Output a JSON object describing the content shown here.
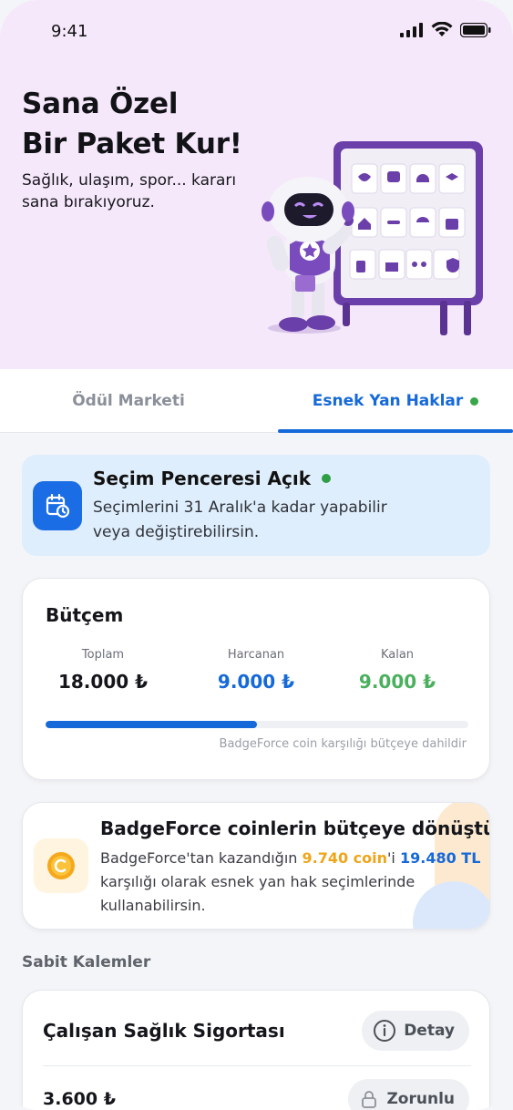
{
  "status": {
    "time": "9:41"
  },
  "hero": {
    "title_line1": "Sana Özel",
    "title_line2": "Bir Paket Kur!",
    "subtitle_line1": "Sağlık, ulaşım, spor... kararı",
    "subtitle_line2": "sana bırakıyoruz."
  },
  "tabs": [
    {
      "label": "Ödül Marketi",
      "active": false
    },
    {
      "label": "Esnek Yan Haklar",
      "active": true
    }
  ],
  "banner": {
    "title": "Seçim Penceresi Açık",
    "line1": "Seçimlerini 31 Aralık'a kadar yapabilir",
    "line2": "veya değiştirebilirsin.",
    "icon": "calendar-clock-icon"
  },
  "budget": {
    "title": "Bütçem",
    "total_label": "Toplam",
    "total_value": "18.000 ₺",
    "spent_label": "Harcanan",
    "spent_value": "9.000 ₺",
    "left_label": "Kalan",
    "left_value": "9.000 ₺",
    "progress_fraction": 0.5,
    "note": "BadgeForce coin karşılığı bütçeye dahildir"
  },
  "coin": {
    "title": "BadgeForce coinlerin bütçeye dönüştü",
    "text_pre": "BadgeForce'tan kazandığın ",
    "coin_amount": "9.740 coin",
    "text_mid": "'i ",
    "tl_amount": "19.480 TL",
    "line2": "karşılığı olarak esnek yan hak seçimlerinde",
    "line3": "kullanabilirsin."
  },
  "fixed_section": {
    "label": "Sabit Kalemler",
    "item_title": "Çalışan Sağlık Sigortası",
    "detail_label": "Detay",
    "price": "3.600 ₺",
    "required_label": "Zorunlu"
  },
  "colors": {
    "accent": "#1569d8",
    "hero_bg": "#f6e8fb",
    "success": "#39a64a",
    "coin_orange": "#eea51c",
    "robot_purple": "#6b3fa9"
  }
}
